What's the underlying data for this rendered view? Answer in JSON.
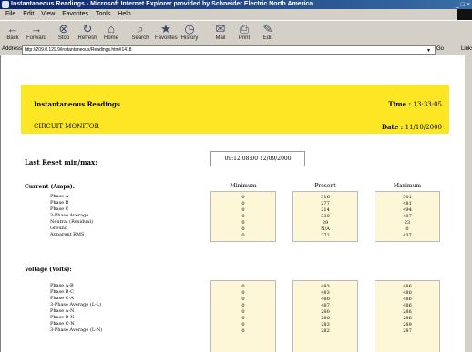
{
  "window": {
    "title": "Instantaneous Readings - Microsoft Internet Explorer provided by Schneider Electric North America",
    "controls": "_ □ ×"
  },
  "menu": [
    "File",
    "Edit",
    "View",
    "Favorites",
    "Tools",
    "Help"
  ],
  "toolbar": [
    {
      "icon": "back-arrow-icon",
      "glyph": "←",
      "label": "Back"
    },
    {
      "icon": "forward-arrow-icon",
      "glyph": "→",
      "label": "Forward"
    },
    {
      "icon": "stop-icon",
      "glyph": "⊗",
      "label": "Stop"
    },
    {
      "icon": "refresh-icon",
      "glyph": "↻",
      "label": "Refresh"
    },
    {
      "icon": "home-icon",
      "glyph": "⌂",
      "label": "Home"
    },
    {
      "icon": "search-icon",
      "glyph": "⌕",
      "label": "Search"
    },
    {
      "icon": "favorites-icon",
      "glyph": "★",
      "label": "Favorites"
    },
    {
      "icon": "history-icon",
      "glyph": "◷",
      "label": "History"
    },
    {
      "icon": "mail-icon",
      "glyph": "✉",
      "label": "Mail"
    },
    {
      "icon": "print-icon",
      "glyph": "⎙",
      "label": "Print"
    },
    {
      "icon": "edit-icon",
      "glyph": "✎",
      "label": "Edit"
    }
  ],
  "address": {
    "label": "Address",
    "url": "http://209.0.129.9/instantaneous/Readings.htm#1418",
    "go": "Go",
    "links": "Links"
  },
  "banner": {
    "title": "Instantaneous Readings",
    "subtitle": "CIRCUIT MONITOR",
    "time_label": "Time :",
    "time_value": "13:33:05",
    "date_label": "Date :",
    "date_value": "11/10/2000"
  },
  "last_reset": {
    "label": "Last Reset min/max:",
    "value": "09:12:08:00   12/09/2000"
  },
  "columns": [
    "Minimum",
    "Present",
    "Maximum"
  ],
  "current": {
    "heading": "Current (Amps):",
    "rows": [
      "Phase A",
      "Phase B",
      "Phase C",
      "3-Phase Average",
      "Neutral (Residual)",
      "Ground",
      "Apparent RMS"
    ],
    "minimum": [
      "0",
      "0",
      "0",
      "0",
      "0",
      "0",
      "0"
    ],
    "present": [
      "316",
      "277",
      "214",
      "330",
      "29",
      "N/A",
      "372"
    ],
    "maximum": [
      "501",
      "481",
      "494",
      "487",
      "23",
      "0",
      "437"
    ]
  },
  "voltage": {
    "heading": "Voltage (Volts):",
    "rows": [
      "Phase A-B",
      "Phase B-C",
      "Phase C-A",
      "3-Phase Average (L-L)",
      "Phase A-N",
      "Phase B-N",
      "Phase C-N",
      "3-Phase Average (L-N)"
    ],
    "minimum": [
      "0",
      "0",
      "0",
      "0",
      "0",
      "0",
      "0",
      "0"
    ],
    "present": [
      "483",
      "483",
      "480",
      "487",
      "280",
      "280",
      "283",
      "282"
    ],
    "maximum": [
      "486",
      "480",
      "486",
      "486",
      "286",
      "286",
      "289",
      "287"
    ]
  }
}
